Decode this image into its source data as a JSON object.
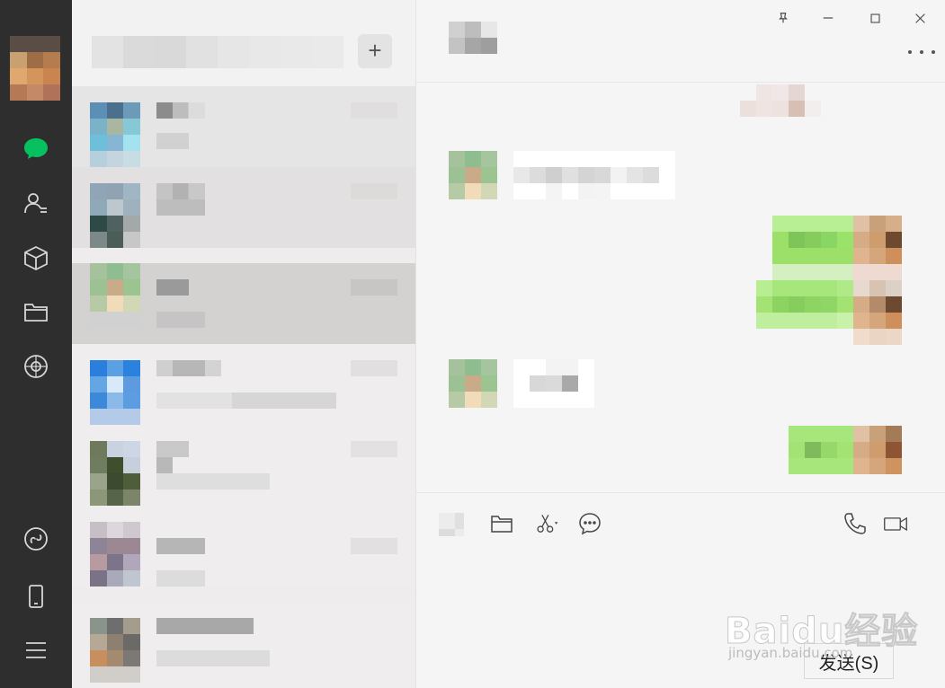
{
  "window": {
    "pin_icon": "pin-icon",
    "minimize_icon": "minimize-icon",
    "maximize_icon": "maximize-icon",
    "close_icon": "close-icon"
  },
  "sidebar": {
    "items": [
      {
        "name": "chat-icon",
        "color": "#07c160",
        "active": true
      },
      {
        "name": "contacts-icon",
        "color": "#d6d6d6"
      },
      {
        "name": "favorites-icon",
        "color": "#d6d6d6"
      },
      {
        "name": "files-icon",
        "color": "#d6d6d6"
      },
      {
        "name": "moments-icon",
        "color": "#d6d6d6"
      },
      {
        "name": "mini-program-icon",
        "color": "#d6d6d6"
      },
      {
        "name": "phone-icon",
        "color": "#d6d6d6"
      },
      {
        "name": "menu-icon",
        "color": "#d6d6d6"
      }
    ]
  },
  "search": {
    "add_label": "+"
  },
  "chat_toolbar": {
    "tools": [
      "emoji-icon",
      "folder-icon",
      "scissors-icon",
      "chat-history-icon"
    ],
    "right_tools": [
      "voice-call-icon",
      "video-call-icon"
    ]
  },
  "send_button": {
    "label": "发送(S)"
  },
  "watermark": {
    "main": "Baidu经验",
    "sub": "jingyan.baidu.com"
  },
  "colors": {
    "accent": "#07c160",
    "sidebar_bg": "#2e2e2e",
    "list_bg": "#eeecec",
    "chat_bg": "#f5f5f5",
    "bubble_self": "#95ec69",
    "bubble_other": "#ffffff"
  }
}
